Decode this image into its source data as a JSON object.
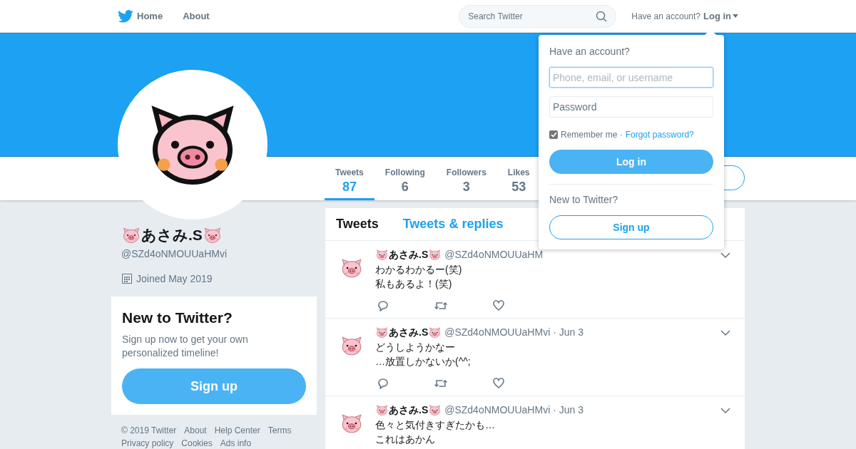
{
  "nav": {
    "items": [
      {
        "label": "Home"
      },
      {
        "label": "About"
      }
    ],
    "search": {
      "placeholder": "Search Twitter"
    },
    "account_prompt": "Have an account?",
    "login_link": "Log in"
  },
  "profile": {
    "name": "あさみ.S",
    "handle": "@SZd4oNMOUUaHMvi",
    "joined": "Joined May 2019"
  },
  "stats": [
    {
      "label": "Tweets",
      "value": "87",
      "selected": true
    },
    {
      "label": "Following",
      "value": "6",
      "selected": false
    },
    {
      "label": "Followers",
      "value": "3",
      "selected": false
    },
    {
      "label": "Likes",
      "value": "53",
      "selected": false
    }
  ],
  "signup_card": {
    "title": "New to Twitter?",
    "text": "Sign up now to get your own personalized timeline!",
    "button": "Sign up"
  },
  "footer_links": [
    "© 2019 Twitter",
    "About",
    "Help Center",
    "Terms",
    "Privacy policy",
    "Cookies",
    "Ads info"
  ],
  "timeline_tabs": [
    {
      "label": "Tweets",
      "selected": true
    },
    {
      "label": "Tweets & replies",
      "selected": false
    }
  ],
  "tweets": [
    {
      "name": "あさみ.S",
      "handle": "@SZd4oNMOUUaHM",
      "lines": [
        "わかるわかるー(笑)",
        "私もあるよ！(笑)"
      ]
    },
    {
      "name": "あさみ.S",
      "handle": "@SZd4oNMOUUaHMvi",
      "date": "· Jun 3",
      "lines": [
        "どうしようかなー",
        "…放置しかないか(^^;"
      ]
    },
    {
      "name": "あさみ.S",
      "handle": "@SZd4oNMOUUaHMvi",
      "date": "· Jun 3",
      "lines": [
        "色々と気付きすぎたかも…",
        "これはあかん"
      ]
    }
  ],
  "login_dropdown": {
    "title": "Have an account?",
    "username_placeholder": "Phone, email, or username",
    "password_placeholder": "Password",
    "remember_label": "Remember me ·",
    "remember_checked": true,
    "forgot_link": "Forgot password?",
    "login_button": "Log in",
    "new_prompt": "New to Twitter?",
    "signup_button": "Sign up"
  }
}
